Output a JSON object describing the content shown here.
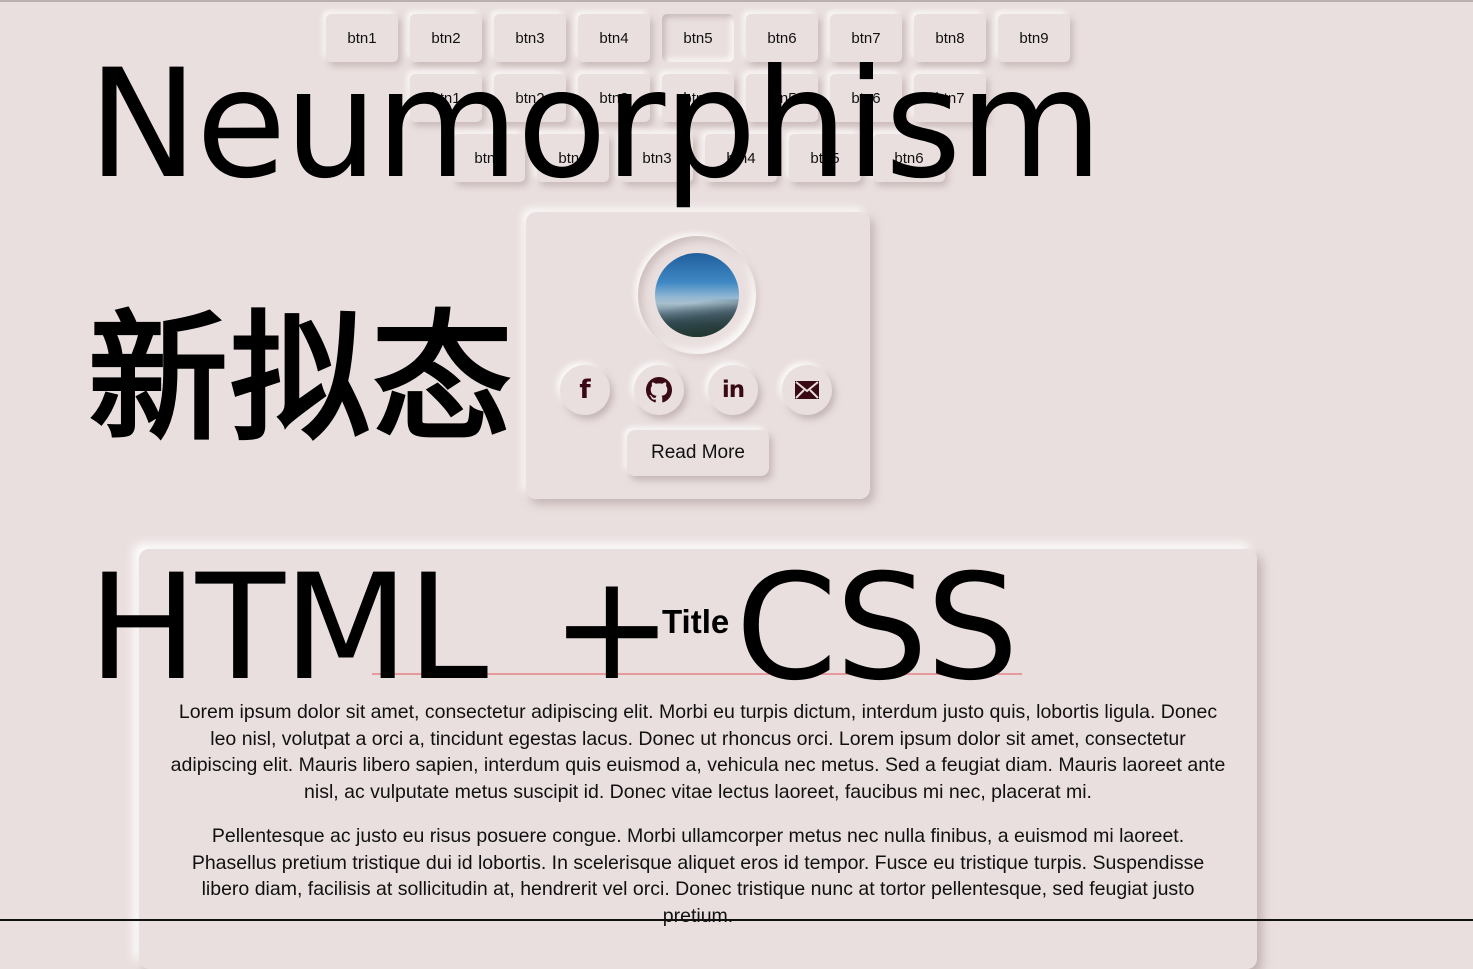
{
  "headings": {
    "title_en": "Neumorphism",
    "title_cn": "新拟态",
    "subtitle": "HTML + CSS"
  },
  "button_rows": [
    {
      "buttons": [
        "btn1",
        "btn2",
        "btn3",
        "btn4",
        "btn5",
        "btn6",
        "btn7",
        "btn8",
        "btn9"
      ],
      "active_index": 4
    },
    {
      "buttons": [
        "btn1",
        "btn2",
        "btn3",
        "btn4",
        "btn5",
        "btn6",
        "btn7"
      ]
    },
    {
      "buttons": [
        "btn1",
        "btn2",
        "btn3",
        "btn4",
        "btn5",
        "btn6"
      ]
    }
  ],
  "profile_card": {
    "avatar_alt": "mountain landscape",
    "socials": [
      {
        "name": "facebook",
        "icon": "facebook-icon",
        "glyph": "f"
      },
      {
        "name": "github",
        "icon": "github-icon"
      },
      {
        "name": "linkedin",
        "icon": "linkedin-icon",
        "glyph": "in"
      },
      {
        "name": "email",
        "icon": "mail-icon"
      }
    ],
    "read_more_label": "Read More",
    "icon_color": "#3a0a14"
  },
  "article": {
    "title": "Title",
    "rule_color": "#e79a9c",
    "paragraphs": [
      "Lorem ipsum dolor sit amet, consectetur adipiscing elit. Morbi eu turpis dictum, interdum justo quis, lobortis ligula. Donec leo nisl, volutpat a orci a, tincidunt egestas lacus. Donec ut rhoncus orci. Lorem ipsum dolor sit amet, consectetur adipiscing elit. Mauris libero sapien, interdum quis euismod a, vehicula nec metus. Sed a feugiat diam. Mauris laoreet ante nisl, ac vulputate metus suscipit id. Donec vitae lectus laoreet, faucibus mi nec, placerat mi.",
      "Pellentesque ac justo eu risus posuere congue. Morbi ullamcorper metus nec nulla finibus, a euismod mi laoreet. Phasellus pretium tristique dui id lobortis. In scelerisque aliquet eros id tempor. Fusce eu tristique turpis. Suspendisse libero diam, facilisis at sollicitudin at, hendrerit vel orci. Donec tristique nunc at tortor pellentesque, sed feugiat justo pretium."
    ]
  },
  "theme": {
    "background": "#e9dfde"
  }
}
